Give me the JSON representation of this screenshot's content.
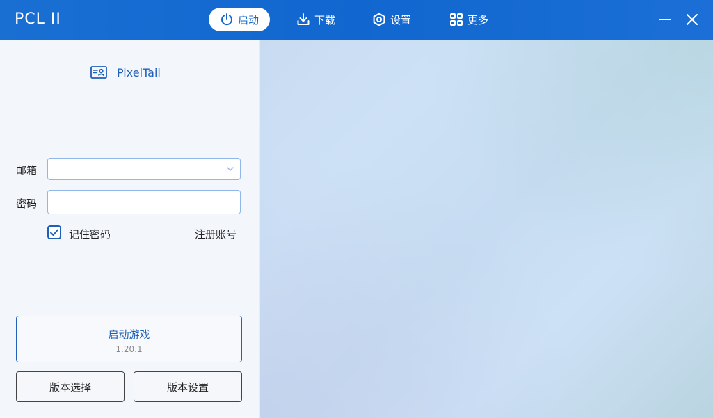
{
  "app": {
    "title": "PCL II"
  },
  "nav": {
    "launch": "启动",
    "download": "下载",
    "settings": "设置",
    "more": "更多"
  },
  "account": {
    "name": "PixelTail",
    "icon": "id-card-icon"
  },
  "form": {
    "email_label": "邮箱",
    "email_value": "",
    "password_label": "密码",
    "password_value": "",
    "remember_label": "记住密码",
    "remember_checked": true,
    "register_label": "注册账号"
  },
  "launch_button": {
    "title": "启动游戏",
    "version": "1.20.1"
  },
  "buttons": {
    "version_select": "版本选择",
    "version_settings": "版本设置"
  },
  "colors": {
    "titlebar": "#1167cf",
    "accent": "#1f5fb8"
  }
}
